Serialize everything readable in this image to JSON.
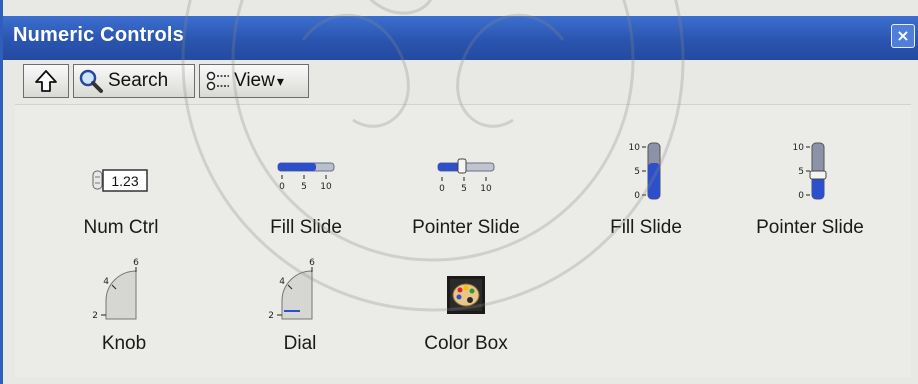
{
  "window": {
    "title": "Numeric Controls",
    "close_glyph": "×",
    "title_color": "#2a55b0"
  },
  "toolbar": {
    "up_icon": "up-arrow-icon",
    "search_label": "Search",
    "view_label": "View",
    "view_arrow": "▾"
  },
  "palette": {
    "items": [
      {
        "label": "Num Ctrl",
        "icon": "numeric-control-icon",
        "value": "1.23"
      },
      {
        "label": "Fill Slide",
        "icon": "horizontal-fill-slide-icon",
        "ticks": [
          "0",
          "5",
          "10"
        ]
      },
      {
        "label": "Pointer Slide",
        "icon": "horizontal-pointer-slide-icon",
        "ticks": [
          "0",
          "5",
          "10"
        ]
      },
      {
        "label": "Fill Slide",
        "icon": "vertical-fill-slide-icon",
        "ticks": [
          "10",
          "5",
          "0"
        ]
      },
      {
        "label": "Pointer Slide",
        "icon": "vertical-pointer-slide-icon",
        "ticks": [
          "10",
          "5",
          "0"
        ]
      },
      {
        "label": "Knob",
        "icon": "knob-icon",
        "ticks": [
          "2",
          "4",
          "6"
        ]
      },
      {
        "label": "Dial",
        "icon": "dial-icon",
        "ticks": [
          "2",
          "4",
          "6"
        ]
      },
      {
        "label": "Color Box",
        "icon": "color-box-icon"
      }
    ]
  }
}
